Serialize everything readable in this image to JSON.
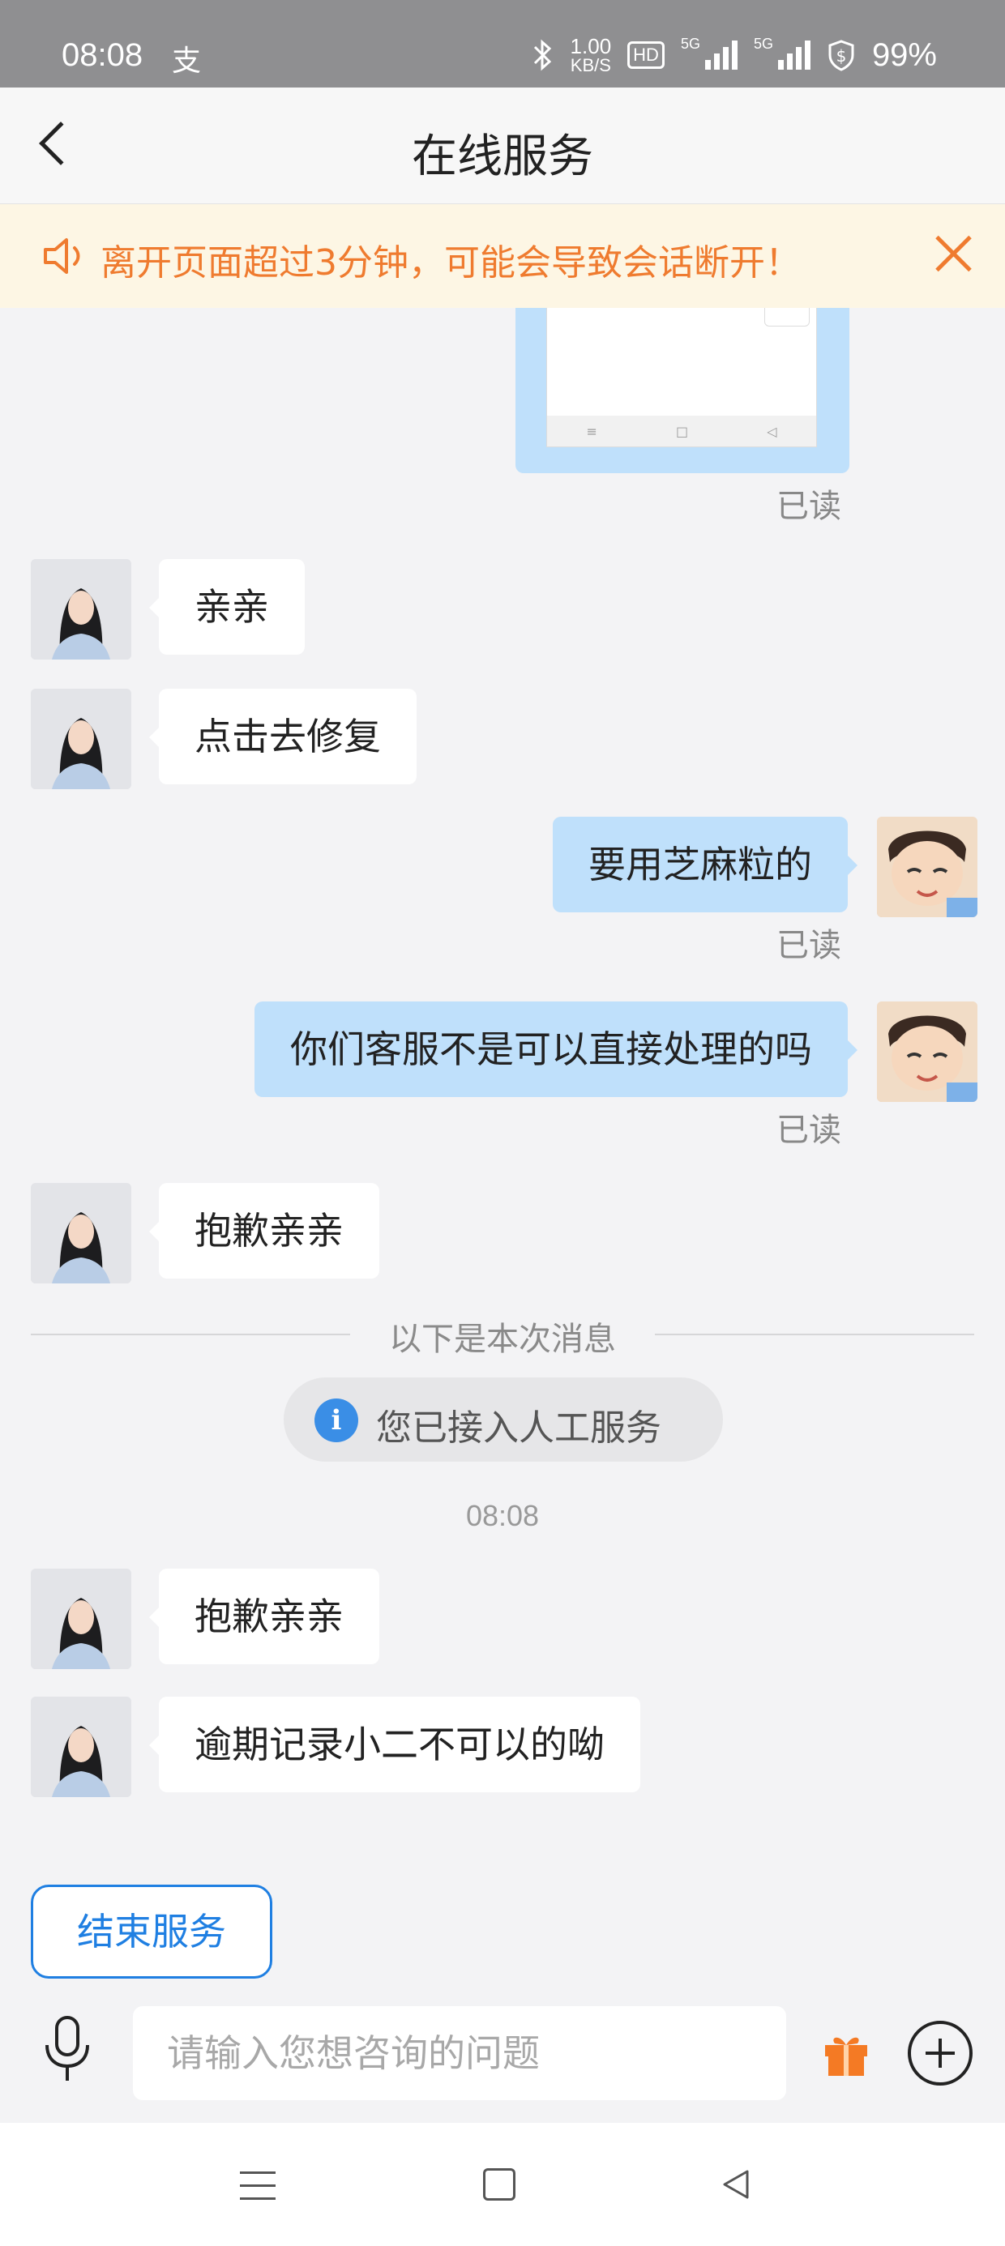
{
  "status_bar": {
    "time": "08:08",
    "alipay_glyph": "支",
    "net_speed_value": "1.00",
    "net_speed_unit": "KB/S",
    "hd_label": "HD",
    "signal1_label": "5G",
    "signal2_label": "5G",
    "battery": "99%"
  },
  "header": {
    "title": "在线服务"
  },
  "notice": {
    "text": "离开页面超过3分钟，可能会导致会话断开！",
    "color": "#ef7b2f"
  },
  "messages": {
    "read_label": "已读",
    "agent_1": "亲亲",
    "agent_2": "点击去修复",
    "user_1": "要用芝麻粒的",
    "user_2": "你们客服不是可以直接处理的吗",
    "agent_3": "抱歉亲亲",
    "agent_4": "抱歉亲亲",
    "agent_5": "逾期记录小二不可以的呦"
  },
  "divider": {
    "text": "以下是本次消息"
  },
  "system_message": {
    "text": "您已接入人工服务"
  },
  "timestamp": "08:08",
  "end_service": {
    "label": "结束服务"
  },
  "input": {
    "placeholder": "请输入您想咨询的问题"
  },
  "colors": {
    "accent": "#1f7fe2",
    "user_bubble": "#bfe0fb",
    "background": "#f3f3f5"
  }
}
